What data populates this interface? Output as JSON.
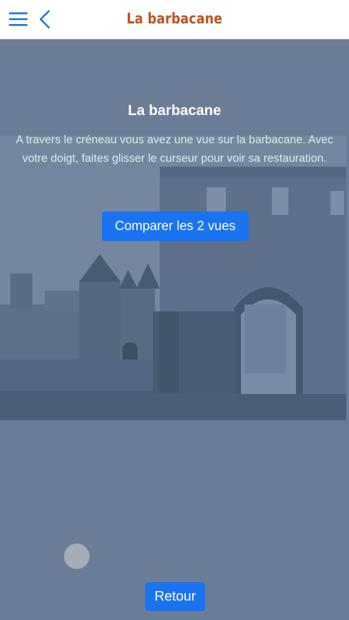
{
  "header": {
    "title": "La barbacane",
    "accent_color": "#c0501e",
    "icon_color": "#1a73d8",
    "menu_icon": "hamburger-menu-icon",
    "back_icon": "chevron-left-icon"
  },
  "content": {
    "title": "La barbacane",
    "description": "A travers le créneau vous avez une vue sur la barbacane. Avec votre doigt, faites glisser le curseur pour voir sa restauration.",
    "compare_button": "Comparer les 2 vues",
    "back_button": "Retour",
    "button_color": "#1a73f0",
    "background_color": "#6b7d96"
  }
}
